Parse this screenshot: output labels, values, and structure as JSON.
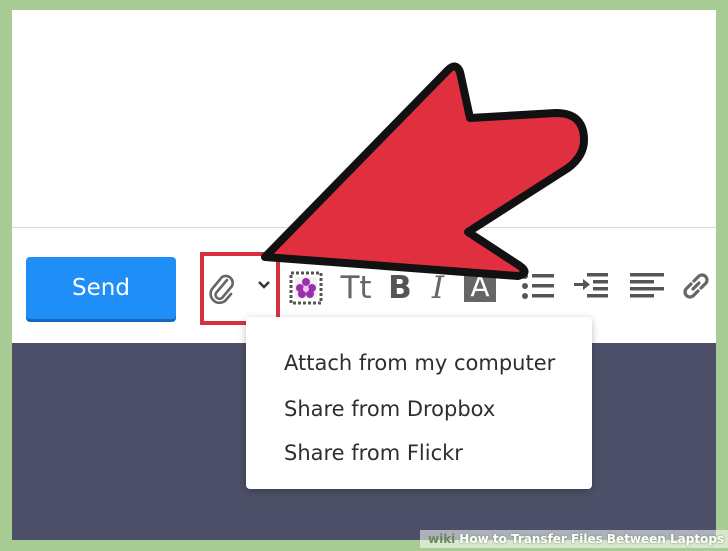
{
  "toolbar": {
    "send_label": "Send",
    "icons": [
      "paperclip-icon",
      "chevron-down-icon",
      "stationery-icon",
      "text-size-icon",
      "bold-icon",
      "italic-icon",
      "text-color-icon",
      "bullet-list-icon",
      "indent-icon",
      "align-left-icon",
      "link-icon"
    ],
    "bold_glyph": "B",
    "italic_glyph": "I",
    "text_size_glyph": "Tt",
    "text_color_glyph": "A"
  },
  "attach_menu": {
    "items": [
      {
        "label": "Attach from my computer"
      },
      {
        "label": "Share from Dropbox"
      },
      {
        "label": "Share from Flickr"
      }
    ]
  },
  "caption": {
    "brand": "wiki",
    "title": "How to Transfer Files Between Laptops"
  },
  "colors": {
    "send_button": "#1f8ef7",
    "arrow": "#e03040",
    "highlight": "#d8303e",
    "dark_panel": "#4d5068",
    "border": "#a9cc94"
  }
}
